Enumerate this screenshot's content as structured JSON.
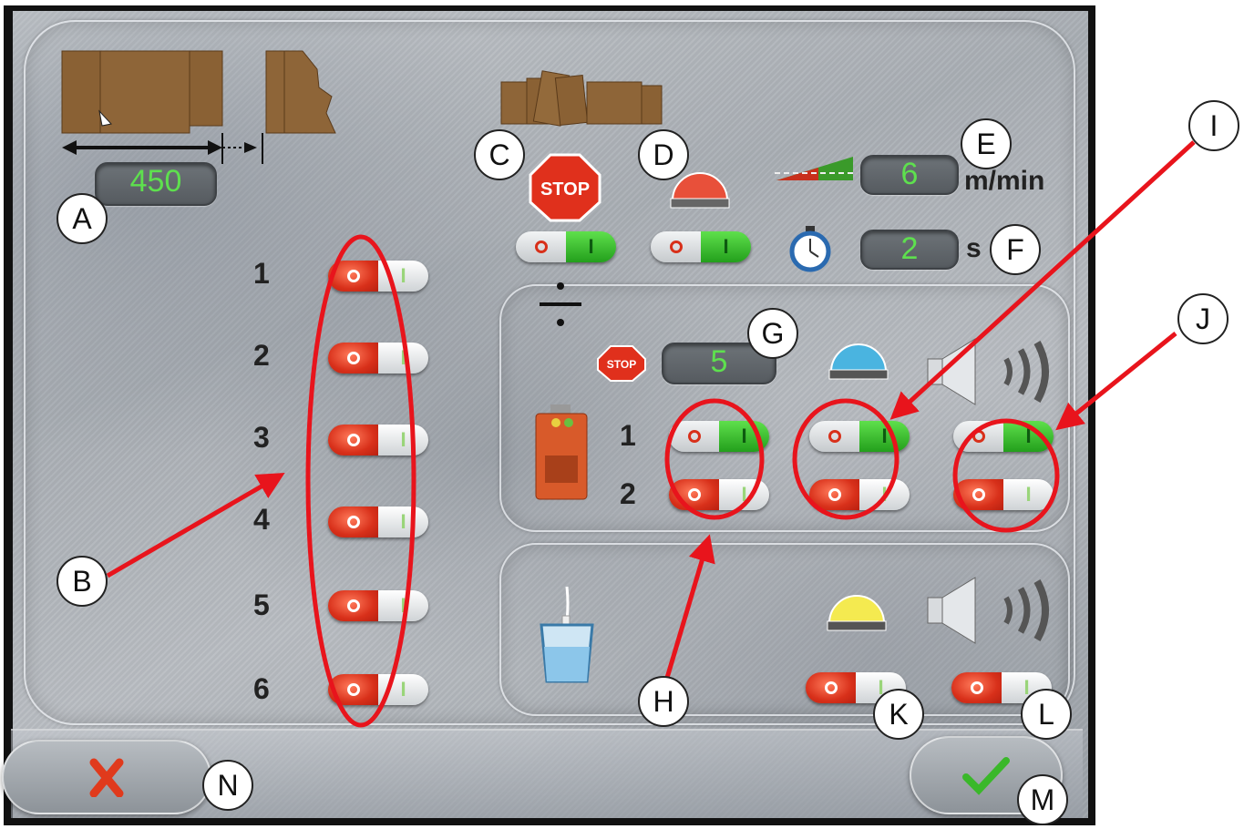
{
  "length": {
    "value": "450"
  },
  "speed": {
    "value": "6",
    "unit": "m/min"
  },
  "timer": {
    "value": "2",
    "unit": "s"
  },
  "stop_count": {
    "value": "5"
  },
  "stop_label": "STOP",
  "rows": [
    "1",
    "2",
    "3",
    "4",
    "5",
    "6"
  ],
  "sensor_rows": [
    "1",
    "2"
  ],
  "toggles": {
    "stop_enable": "on",
    "beacon_enable": "on",
    "rows": [
      "off",
      "off",
      "off",
      "off",
      "off",
      "off"
    ],
    "sensor_stop": [
      "on",
      "off"
    ],
    "sensor_beacon": [
      "on",
      "off"
    ],
    "sensor_horn": [
      "on",
      "off"
    ],
    "water_beacon": "off",
    "water_horn": "off"
  },
  "callouts": [
    "A",
    "B",
    "C",
    "D",
    "E",
    "F",
    "G",
    "H",
    "I",
    "J",
    "K",
    "L",
    "M",
    "N"
  ],
  "colors": {
    "display_text": "#5ee04e",
    "toggle_on": "#3ec82e",
    "toggle_off": "#e04424",
    "annotation": "#e8141c"
  },
  "icons": [
    "box-strip-icon",
    "box-end-icon",
    "stacked-boxes-icon",
    "stop-sign-icon",
    "red-beacon-icon",
    "speed-ramp-icon",
    "stopwatch-icon",
    "divide-icon",
    "sensor-unit-icon",
    "blue-beacon-icon",
    "speaker-icon",
    "water-tank-icon",
    "yellow-beacon-icon",
    "cancel-x-icon",
    "confirm-check-icon"
  ]
}
